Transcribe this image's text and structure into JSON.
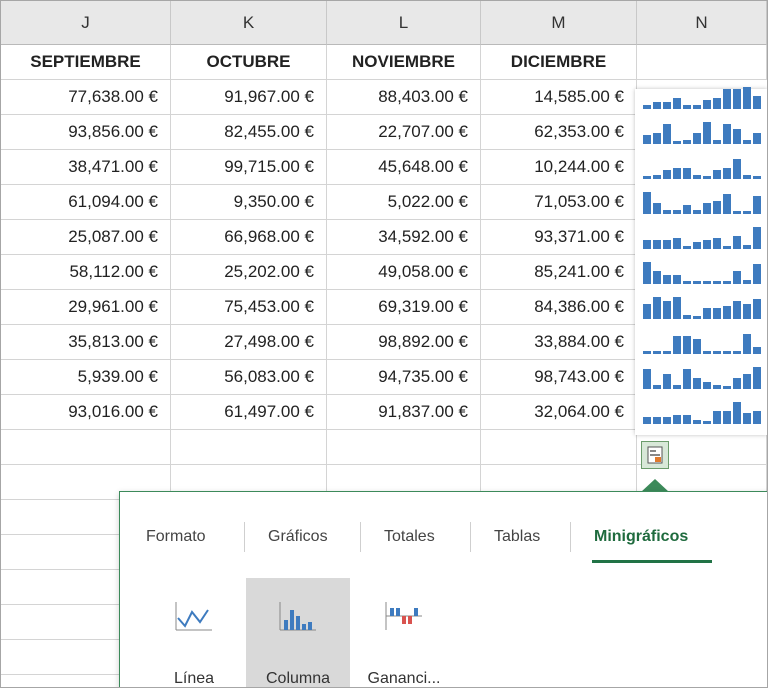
{
  "columns": [
    "J",
    "K",
    "L",
    "M",
    "N"
  ],
  "headers": [
    "SEPTIEMBRE",
    "OCTUBRE",
    "NOVIEMBRE",
    "DICIEMBRE",
    ""
  ],
  "rows": [
    [
      "77,638.00 €",
      "91,967.00 €",
      "88,403.00 €",
      "14,585.00 €"
    ],
    [
      "93,856.00 €",
      "82,455.00 €",
      "22,707.00 €",
      "62,353.00 €"
    ],
    [
      "38,471.00 €",
      "99,715.00 €",
      "45,648.00 €",
      "10,244.00 €"
    ],
    [
      "61,094.00 €",
      "9,350.00 €",
      "5,022.00 €",
      "71,053.00 €"
    ],
    [
      "25,087.00 €",
      "66,968.00 €",
      "34,592.00 €",
      "93,371.00 €"
    ],
    [
      "58,112.00 €",
      "25,202.00 €",
      "49,058.00 €",
      "85,241.00 €"
    ],
    [
      "29,961.00 €",
      "75,453.00 €",
      "69,319.00 €",
      "84,386.00 €"
    ],
    [
      "35,813.00 €",
      "27,498.00 €",
      "98,892.00 €",
      "33,884.00 €"
    ],
    [
      "5,939.00 €",
      "56,083.00 €",
      "94,735.00 €",
      "98,743.00 €"
    ],
    [
      "93,016.00 €",
      "61,497.00 €",
      "91,837.00 €",
      "32,064.00 €"
    ]
  ],
  "sparklines": [
    [
      0.2,
      0.3,
      0.3,
      0.5,
      0.2,
      0.2,
      0.4,
      0.5,
      0.9,
      0.9,
      1.0,
      0.6
    ],
    [
      0.4,
      0.5,
      0.9,
      0.1,
      0.2,
      0.5,
      1.0,
      0.2,
      0.9,
      0.7,
      0.2,
      0.5
    ],
    [
      0.1,
      0.2,
      0.4,
      0.5,
      0.5,
      0.2,
      0.1,
      0.4,
      0.5,
      0.9,
      0.2,
      0.1
    ],
    [
      1.0,
      0.5,
      0.2,
      0.2,
      0.4,
      0.2,
      0.5,
      0.6,
      0.9,
      0.1,
      0.1,
      0.8
    ],
    [
      0.4,
      0.4,
      0.4,
      0.5,
      0.1,
      0.3,
      0.4,
      0.5,
      0.1,
      0.6,
      0.2,
      1.0
    ],
    [
      1.0,
      0.6,
      0.4,
      0.4,
      0.1,
      0.1,
      0.1,
      0.1,
      0.1,
      0.6,
      0.2,
      0.9
    ],
    [
      0.7,
      1.0,
      0.8,
      1.0,
      0.2,
      0.1,
      0.5,
      0.5,
      0.6,
      0.8,
      0.7,
      0.9
    ],
    [
      0.1,
      0.1,
      0.1,
      0.8,
      0.8,
      0.7,
      0.1,
      0.1,
      0.1,
      0.1,
      0.9,
      0.3
    ],
    [
      0.9,
      0.2,
      0.7,
      0.2,
      0.9,
      0.5,
      0.3,
      0.2,
      0.1,
      0.5,
      0.7,
      1.0
    ],
    [
      0.3,
      0.3,
      0.3,
      0.4,
      0.4,
      0.2,
      0.1,
      0.6,
      0.6,
      1.0,
      0.5,
      0.6
    ]
  ],
  "spark_color": "#3e7bbf",
  "quick_analysis": {
    "tabs": [
      "Formato",
      "Gráficos",
      "Totales",
      "Tablas",
      "Minigráficos"
    ],
    "active_tab": "Minigráficos",
    "options": [
      "Línea",
      "Columna",
      "Gananci..."
    ],
    "selected_option": "Columna",
    "accent": "#217346"
  }
}
